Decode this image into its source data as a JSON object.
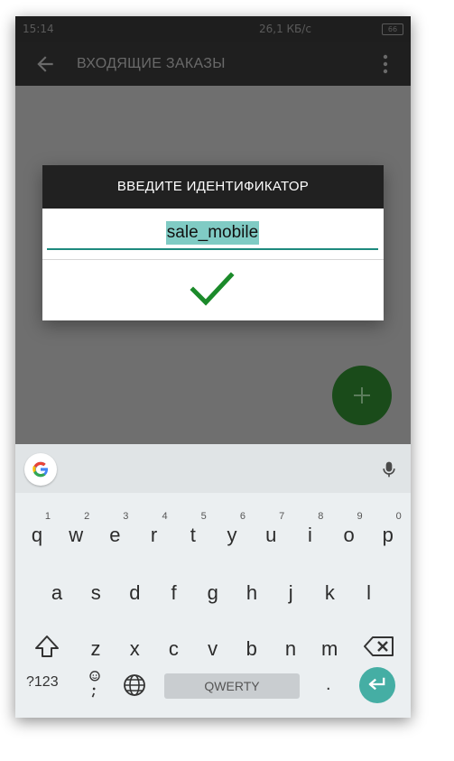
{
  "status_bar": {
    "time": "15:14",
    "speed": "26,1 КБ/с",
    "battery": "66"
  },
  "app_bar": {
    "title": "ВХОДЯЩИЕ ЗАКАЗЫ"
  },
  "dialog": {
    "title": "ВВЕДИТЕ ИДЕНТИФИКАТОР",
    "input_value": "sale_mobile"
  },
  "keyboard": {
    "row1": [
      {
        "label": "q",
        "num": "1"
      },
      {
        "label": "w",
        "num": "2"
      },
      {
        "label": "e",
        "num": "3"
      },
      {
        "label": "r",
        "num": "4"
      },
      {
        "label": "t",
        "num": "5"
      },
      {
        "label": "y",
        "num": "6"
      },
      {
        "label": "u",
        "num": "7"
      },
      {
        "label": "i",
        "num": "8"
      },
      {
        "label": "o",
        "num": "9"
      },
      {
        "label": "p",
        "num": "0"
      }
    ],
    "row2": [
      "a",
      "s",
      "d",
      "f",
      "g",
      "h",
      "j",
      "k",
      "l"
    ],
    "row3": [
      "z",
      "x",
      "c",
      "v",
      "b",
      "n",
      "m"
    ],
    "symbols_label": "?123",
    "space_label": "QWERTY",
    "period_label": "."
  },
  "colors": {
    "accent": "#1e8a7e",
    "check": "#1b8a2a",
    "fab": "#1a4b1a",
    "enter": "#45aea4"
  },
  "icons": [
    "back-arrow-icon",
    "more-vert-icon",
    "check-icon",
    "plus-icon",
    "google-icon",
    "mic-icon",
    "shift-icon",
    "backspace-icon",
    "emoji-icon",
    "globe-icon",
    "enter-icon"
  ]
}
